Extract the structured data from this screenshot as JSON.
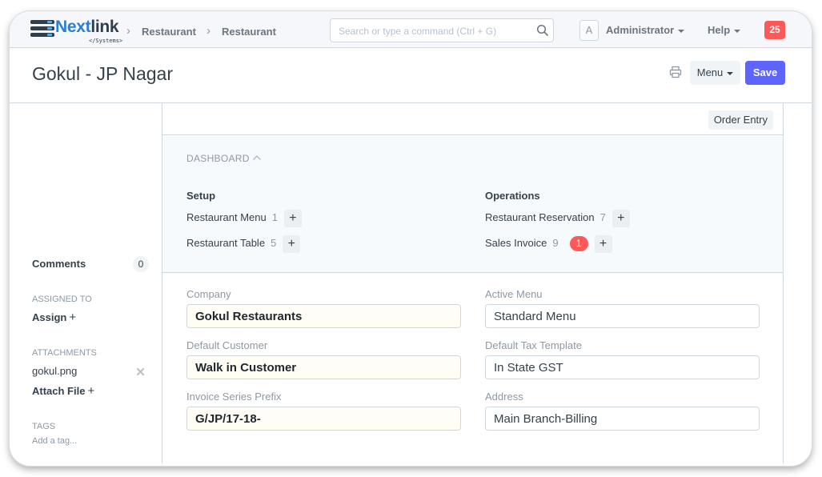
{
  "navbar": {
    "brand": {
      "part1": "Next",
      "part2": "link",
      "tagline": "</Systems>"
    },
    "breadcrumbs": [
      "Restaurant",
      "Restaurant"
    ],
    "search_placeholder": "Search or type a command (Ctrl + G)",
    "avatar_letter": "A",
    "user_label": "Administrator",
    "help_label": "Help",
    "notification_count": "25"
  },
  "page": {
    "title": "Gokul - JP Nagar",
    "menu_label": "Menu",
    "save_label": "Save"
  },
  "sidebar": {
    "comments_label": "Comments",
    "comments_count": "0",
    "assigned_to_label": "ASSIGNED TO",
    "assign_label": "Assign",
    "attachments_label": "ATTACHMENTS",
    "attachment_file": "gokul.png",
    "attach_file_label": "Attach File",
    "tags_label": "TAGS",
    "add_tag_label": "Add a tag..."
  },
  "main": {
    "order_entry_label": "Order Entry",
    "dashboard": {
      "title": "DASHBOARD",
      "groups": [
        {
          "title": "Setup",
          "items": [
            {
              "label": "Restaurant Menu",
              "count": "1",
              "open": ""
            },
            {
              "label": "Restaurant Table",
              "count": "5",
              "open": ""
            }
          ]
        },
        {
          "title": "Operations",
          "items": [
            {
              "label": "Restaurant Reservation",
              "count": "7",
              "open": ""
            },
            {
              "label": "Sales Invoice",
              "count": "9",
              "open": "1"
            }
          ]
        }
      ]
    },
    "form": {
      "company": {
        "label": "Company",
        "value": "Gokul Restaurants"
      },
      "default_customer": {
        "label": "Default Customer",
        "value": "Walk in Customer"
      },
      "invoice_series_prefix": {
        "label": "Invoice Series Prefix",
        "value": "G/JP/17-18-"
      },
      "active_menu": {
        "label": "Active Menu",
        "value": "Standard Menu"
      },
      "default_tax_template": {
        "label": "Default Tax Template",
        "value": "In State GST"
      },
      "address": {
        "label": "Address",
        "value": "Main Branch-Billing"
      }
    }
  },
  "colors": {
    "primary": "#5e64ff",
    "danger": "#ff5858",
    "brand_blue": "#2a7fd4",
    "brand_dark": "#2d3e50"
  }
}
